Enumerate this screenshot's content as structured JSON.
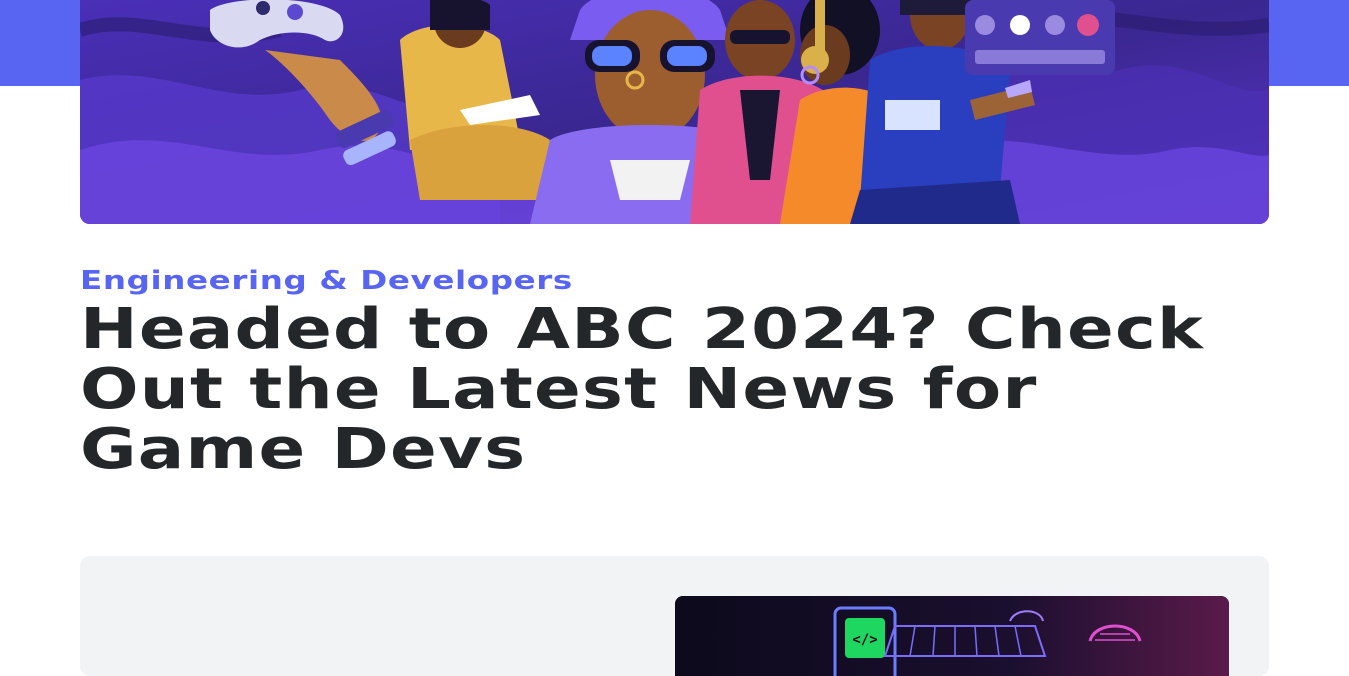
{
  "article": {
    "category": "Engineering & Developers",
    "title": "Headed to ABC 2024? Check Out the Latest News for Game Devs"
  },
  "hero": {
    "description_icon": "illustration-image"
  },
  "colors": {
    "brand": "#5865f2",
    "title": "#23272a",
    "card_bg": "#f2f3f5"
  }
}
